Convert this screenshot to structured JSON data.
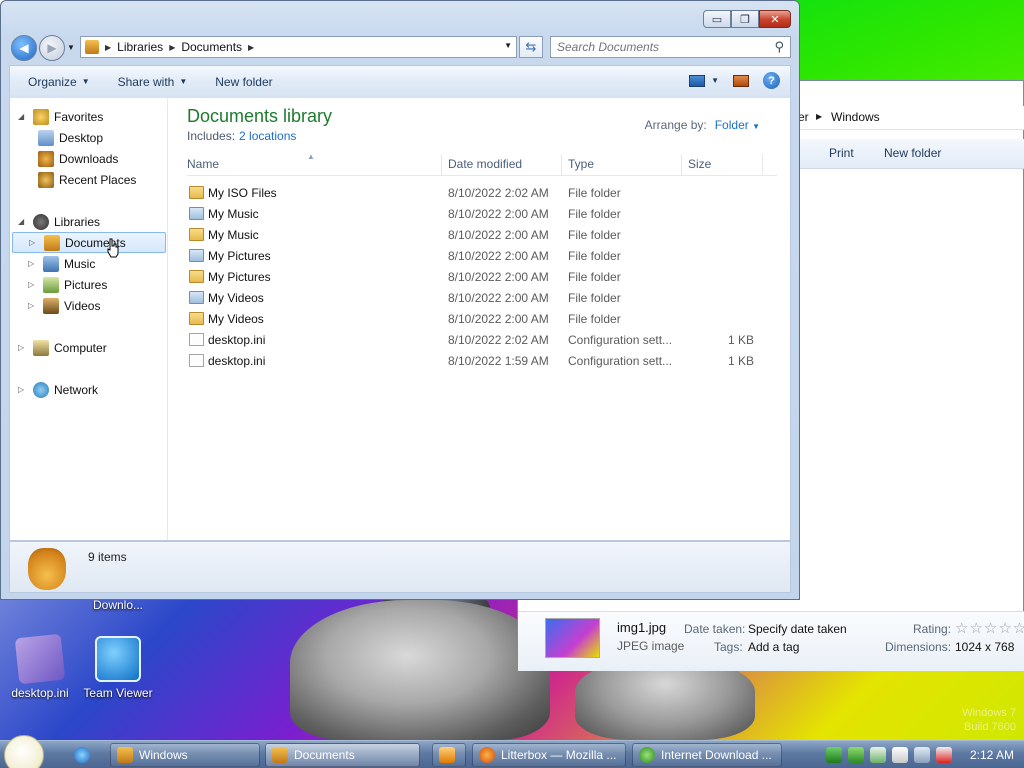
{
  "window": {
    "caption_buttons": {
      "minimize": "▭",
      "maximize": "❐",
      "close": "✕"
    },
    "address": {
      "crumbs": [
        "Libraries",
        "Documents"
      ]
    },
    "search_placeholder": "Search Documents",
    "commands": [
      {
        "label": "Organize",
        "has_dropdown": true
      },
      {
        "label": "Share with",
        "has_dropdown": true
      },
      {
        "label": "New folder",
        "has_dropdown": false
      }
    ],
    "help_glyph": "?"
  },
  "nav": {
    "favorites": {
      "label": "Favorites",
      "items": [
        "Desktop",
        "Downloads",
        "Recent Places"
      ]
    },
    "libraries": {
      "label": "Libraries",
      "items": [
        "Documents",
        "Music",
        "Pictures",
        "Videos"
      ],
      "selected": "Documents"
    },
    "computer": "Computer",
    "network": "Network"
  },
  "library": {
    "title": "Documents library",
    "includes_label": "Includes:",
    "includes_link": "2 locations",
    "arrange_label": "Arrange by:",
    "arrange_value": "Folder"
  },
  "columns": [
    "Name",
    "Date modified",
    "Type",
    "Size"
  ],
  "files": [
    {
      "name": "My ISO Files",
      "date": "8/10/2022 2:02 AM",
      "type": "File folder",
      "size": "",
      "icon": "folder"
    },
    {
      "name": "My Music",
      "date": "8/10/2022 2:00 AM",
      "type": "File folder",
      "size": "",
      "icon": "music-folder"
    },
    {
      "name": "My Music",
      "date": "8/10/2022 2:00 AM",
      "type": "File folder",
      "size": "",
      "icon": "locked-folder"
    },
    {
      "name": "My Pictures",
      "date": "8/10/2022 2:00 AM",
      "type": "File folder",
      "size": "",
      "icon": "pictures-folder"
    },
    {
      "name": "My Pictures",
      "date": "8/10/2022 2:00 AM",
      "type": "File folder",
      "size": "",
      "icon": "locked-folder"
    },
    {
      "name": "My Videos",
      "date": "8/10/2022 2:00 AM",
      "type": "File folder",
      "size": "",
      "icon": "videos-folder"
    },
    {
      "name": "My Videos",
      "date": "8/10/2022 2:00 AM",
      "type": "File folder",
      "size": "",
      "icon": "locked-folder"
    },
    {
      "name": "desktop.ini",
      "date": "8/10/2022 2:02 AM",
      "type": "Configuration sett...",
      "size": "1 KB",
      "icon": "ini-file"
    },
    {
      "name": "desktop.ini",
      "date": "8/10/2022 1:59 AM",
      "type": "Configuration sett...",
      "size": "1 KB",
      "icon": "ini-file"
    }
  ],
  "status": {
    "count": "9 items"
  },
  "background_window": {
    "crumb_tail": "er",
    "crumb": "Windows",
    "commands": [
      "Print",
      "New folder"
    ],
    "details": {
      "filename": "img1.jpg",
      "filetype": "JPEG image",
      "date_taken_label": "Date taken:",
      "date_taken_value": "Specify date taken",
      "tags_label": "Tags:",
      "tags_value": "Add a tag",
      "rating_label": "Rating:",
      "rating_stars": "☆☆☆☆☆",
      "dimensions_label": "Dimensions:",
      "dimensions_value": "1024 x 768"
    }
  },
  "desktop_icons": [
    {
      "label": "Downlo..."
    },
    {
      "label": "desktop.ini"
    },
    {
      "label": "Team Viewer"
    }
  ],
  "watermark": {
    "line1": "Windows 7",
    "line2": "Build 7600"
  },
  "taskbar": {
    "buttons": [
      {
        "label": "Windows",
        "state": "normal"
      },
      {
        "label": "Documents",
        "state": "active"
      },
      {
        "label": "",
        "state": "normal"
      },
      {
        "label": "Litterbox — Mozilla ...",
        "state": "normal"
      },
      {
        "label": "Internet Download ...",
        "state": "normal"
      }
    ],
    "clock": "2:12 AM"
  },
  "colors": {
    "library_title": "#1e7b2e",
    "link": "#1c6fc9",
    "selection": "#d5e8fc"
  }
}
